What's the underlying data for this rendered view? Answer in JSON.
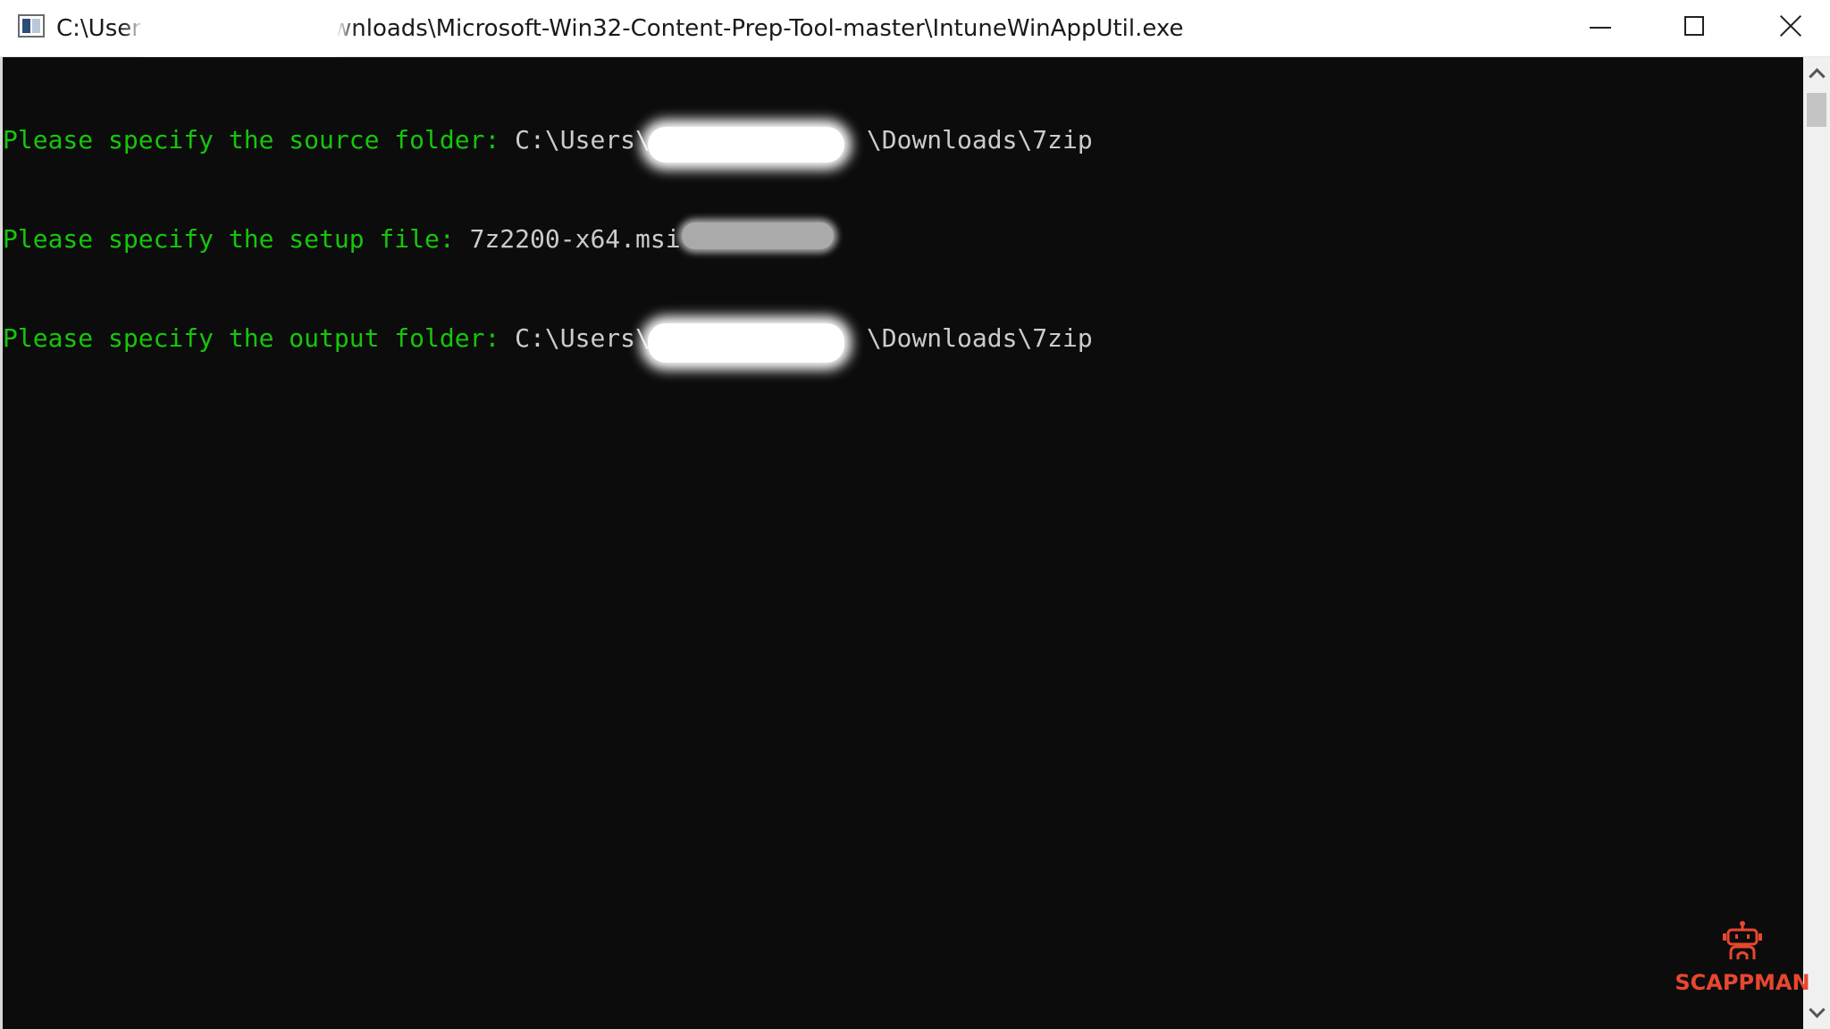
{
  "window": {
    "title_left": "C:\\Users",
    "title_right": "wnloads\\Microsoft-Win32-Content-Prep-Tool-master\\IntuneWinAppUtil.exe",
    "icon": "console-app-icon",
    "controls": {
      "minimize_icon": "minimize-icon",
      "maximize_icon": "maximize-icon",
      "close_icon": "close-icon"
    }
  },
  "console": {
    "lines": [
      {
        "prompt": "Please specify the source folder: ",
        "value_start": "C:\\Users\\",
        "value_end": "\\Downloads\\7zip"
      },
      {
        "prompt": "Please specify the setup file: ",
        "value_start": "7z2200-x64.msi",
        "value_end": ""
      },
      {
        "prompt": "Please specify the output folder: ",
        "value_start": "C:\\Users\\",
        "value_end": "\\Downloads\\7zip"
      }
    ],
    "colors": {
      "background": "#0c0c0c",
      "prompt": "#16c60c",
      "value": "#cccccc"
    }
  },
  "watermark": {
    "text": "SCAPPMAN",
    "icon": "robot-icon",
    "color": "#e8472f"
  }
}
